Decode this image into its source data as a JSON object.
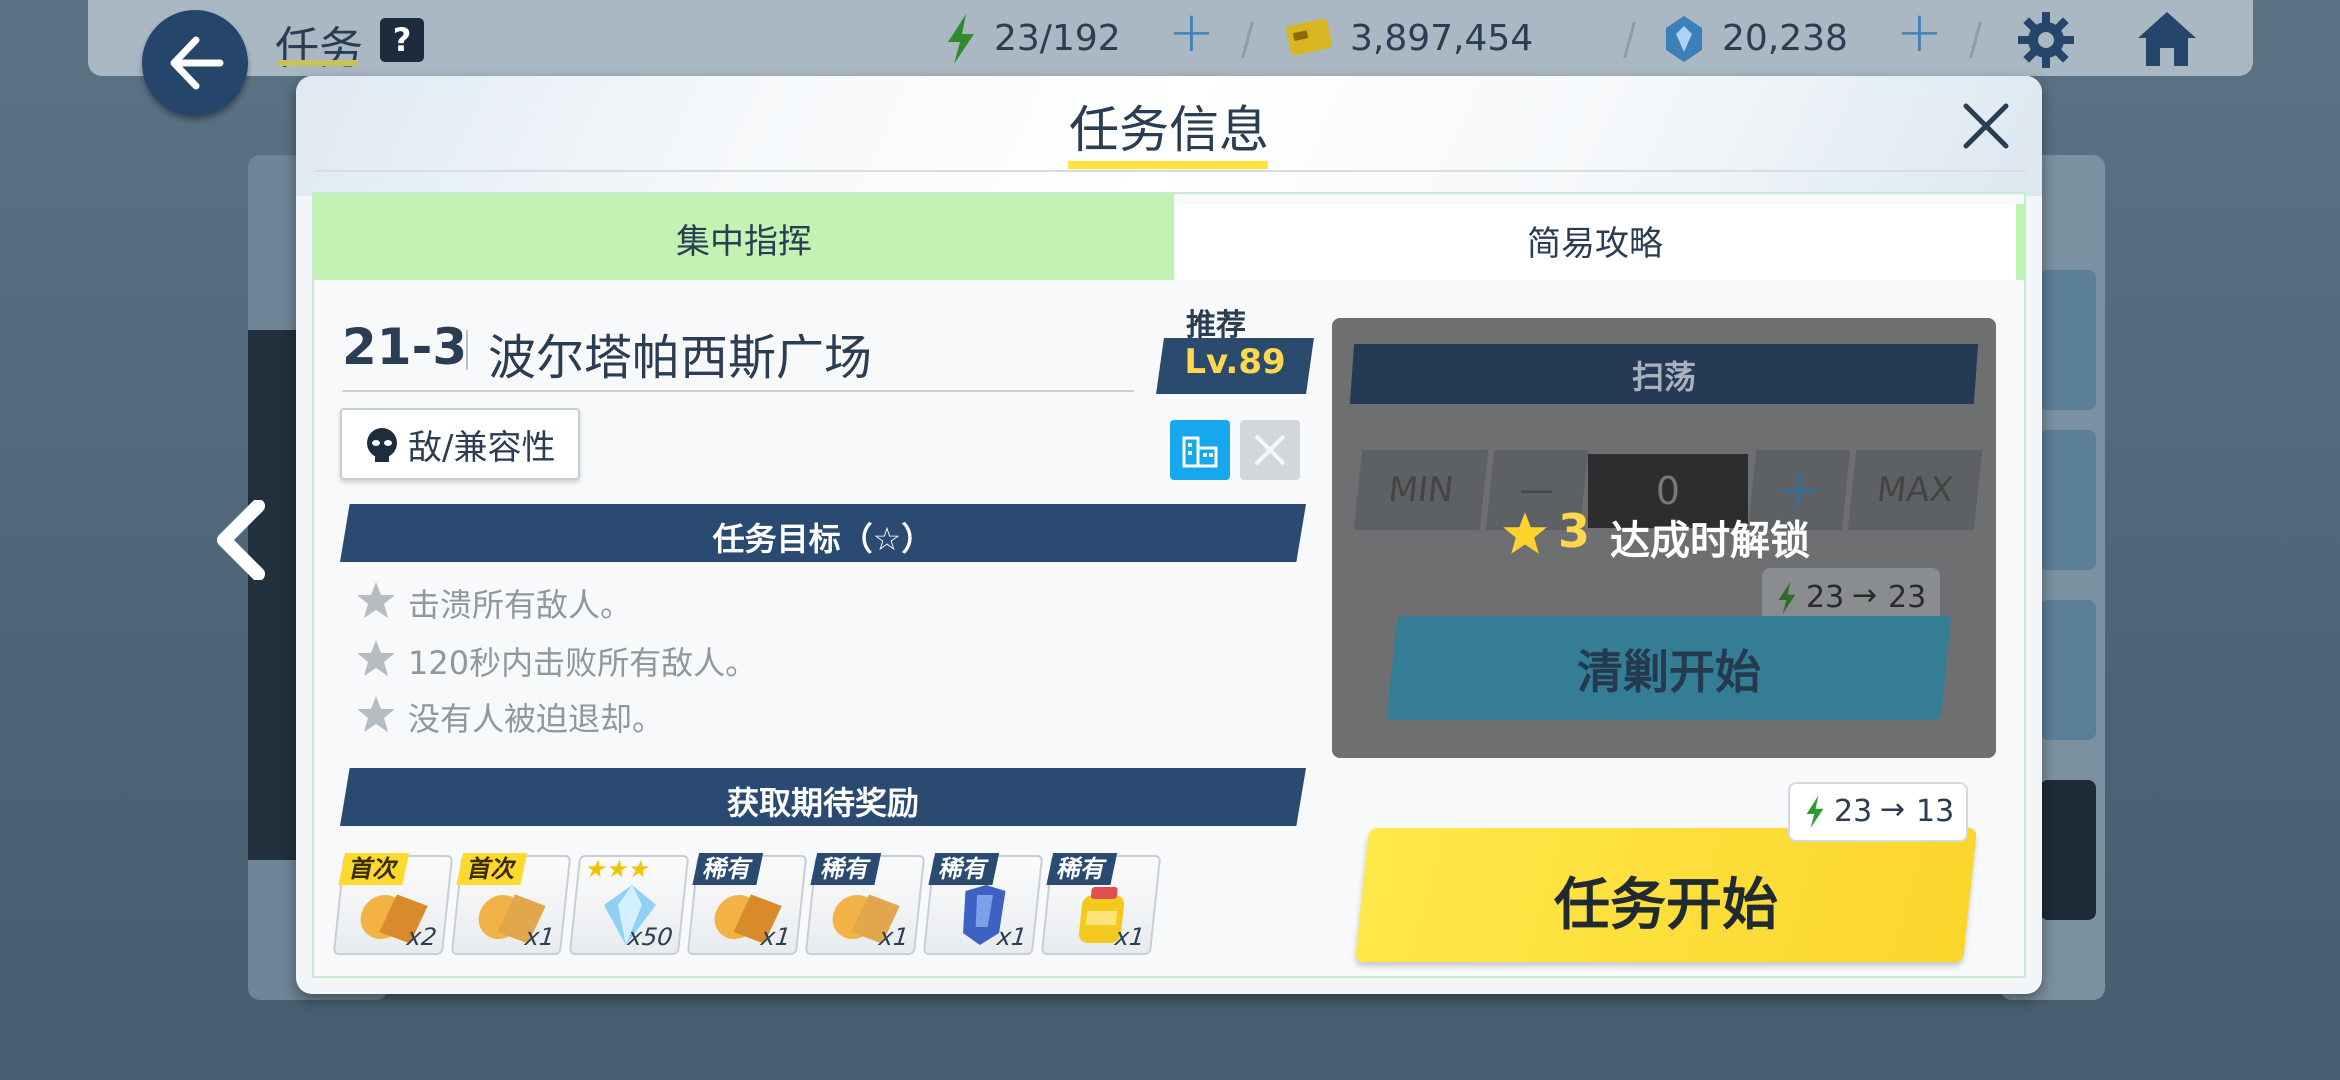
{
  "header": {
    "title": "任务",
    "help": "?",
    "ap": "23/192",
    "credits": "3,897,454",
    "gems": "20,238"
  },
  "modal": {
    "title": "任务信息",
    "tabs": [
      {
        "label": "集中指挥"
      },
      {
        "label": "简易攻略"
      }
    ],
    "stage": {
      "id": "21-3",
      "name": "波尔塔帕西斯广场",
      "recommended_label": "推荐",
      "recommended_level": "Lv.89",
      "enemy_button": "敌/兼容性"
    },
    "objectives_title": "任务目标（☆）",
    "objectives": [
      "击溃所有敌人。",
      "120秒内击败所有敌人。",
      "没有人被迫退却。"
    ],
    "rewards_title": "获取期待奖励",
    "rewards": [
      {
        "tag": "首次",
        "qty": "x2"
      },
      {
        "tag": "首次",
        "qty": "x1"
      },
      {
        "tag": "★★★",
        "qty": "x50"
      },
      {
        "tag": "稀有",
        "qty": "x1"
      },
      {
        "tag": "稀有",
        "qty": "x1"
      },
      {
        "tag": "稀有",
        "qty": "x1"
      },
      {
        "tag": "稀有",
        "qty": "x1"
      }
    ],
    "sweep": {
      "title": "扫荡",
      "min": "MIN",
      "minus": "—",
      "count": "0",
      "plus": "+",
      "max": "MAX",
      "unlock_num": "3",
      "unlock_text": "达成时解锁",
      "ap_from": "23",
      "ap_to": "23",
      "start_label": "清剿开始"
    },
    "start": {
      "label": "任务开始",
      "ap_from": "23",
      "ap_to": "13"
    }
  },
  "colors": {
    "navy": "#2b4a72",
    "yellow": "#ffe53b",
    "green_tab": "#c2f2b4",
    "sky": "#16a7ee"
  }
}
